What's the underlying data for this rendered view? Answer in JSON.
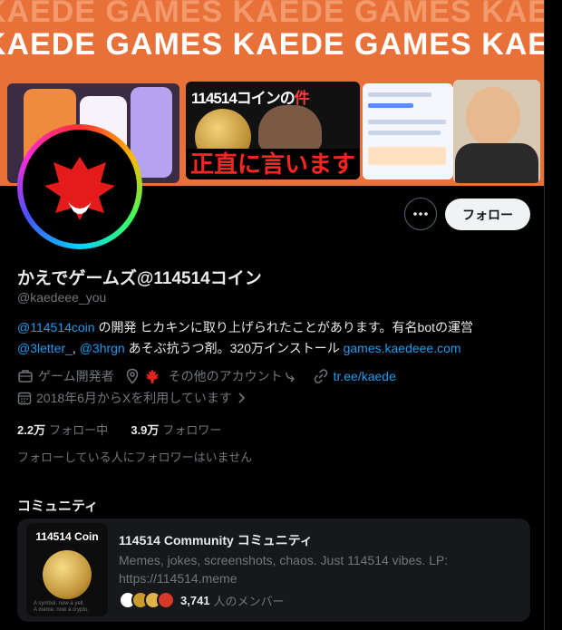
{
  "banner": {
    "brand_text": "KAEDE GAMES",
    "coin_title": "114514コインの",
    "coin_title_accent": "件",
    "coin_caption": "正直に言います"
  },
  "profile": {
    "more_icon": "ellipsis-icon",
    "follow_label": "フォロー",
    "display_name": "かえでゲームズ@114514コイン",
    "handle": "@kaedeee_you",
    "bio": {
      "mention_1": "@114514coin",
      "text_1": " の開発 ヒカキンに取り上げられたことがあります。有名botの運営",
      "mention_2": "@3letter_",
      "mention_3": "@3hrgn",
      "text_2": " あそぶ抗うつ剤。320万インストール ",
      "url": "games.kaedeee.com"
    },
    "meta": {
      "category": "ゲーム開発者",
      "location": "その他のアカウント",
      "website": "tr.ee/kaede",
      "joined": "2018年6月からXを利用しています"
    },
    "stats": {
      "following_count": "2.2万",
      "following_label": "フォロー中",
      "followers_count": "3.9万",
      "followers_label": "フォロワー"
    },
    "followers_notice": "フォローしている人にフォロワーはいません"
  },
  "community_section": {
    "title": "コミュニティ",
    "card": {
      "thumb_title": "114514 Coin",
      "name": "114514 Community コミュニティ",
      "description": "Memes, jokes, screenshots, chaos. Just 114514 vibes. LP: https://114514.meme",
      "member_count": "3,741",
      "member_label": "人のメンバー"
    }
  },
  "colors": {
    "accent": "#1d9bf0",
    "banner": "#e8713a",
    "background": "#000000"
  }
}
